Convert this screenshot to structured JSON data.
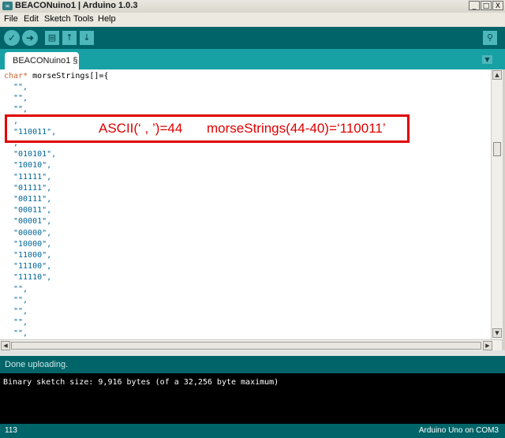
{
  "window": {
    "title": "BEACONuino1 | Arduino 1.0.3",
    "app_icon": "arduino-infinity-icon",
    "controls": {
      "minimize": "_",
      "maximize": "□",
      "close": "X"
    }
  },
  "menu": [
    "File",
    "Edit",
    "Sketch",
    "Tools",
    "Help"
  ],
  "toolbar": {
    "verify": "✓",
    "upload": "➜",
    "new": "▤",
    "open": "↑",
    "save": "↓",
    "serial_monitor": "⚲"
  },
  "tab": {
    "label": "BEACONuino1 §",
    "menu_icon": "▼"
  },
  "code": {
    "first_keyword": "char*",
    "first_rest": " morseStrings[]={",
    "strings": [
      "\"\",",
      "\"\",",
      "\"\",",
      ",",
      "\"110011\",",
      ",",
      "\"010101\",",
      "\"10010\",",
      "\"11111\",",
      "\"01111\",",
      "\"00111\",",
      "\"00011\",",
      "\"00001\",",
      "\"00000\",",
      "\"10000\",",
      "\"11000\",",
      "\"11100\",",
      "\"11110\",",
      "\"\",",
      "\"\",",
      "\"\",",
      "\"\",",
      "\"\","
    ]
  },
  "annotation": {
    "left": "ASCII(‘ , ’)=44",
    "right": "morseStrings(44-40)=‘110011’",
    "color": "#e00000"
  },
  "status": {
    "message": "Done uploading."
  },
  "console": {
    "text": "Binary sketch size: 9,916 bytes (of a 32,256 byte maximum)"
  },
  "footer": {
    "line_number": "113",
    "board": "Arduino Uno on COM3"
  },
  "colors": {
    "toolbar": "#006468",
    "tabbar": "#17a1a5",
    "keyword": "#cc6633",
    "string": "#006699"
  }
}
